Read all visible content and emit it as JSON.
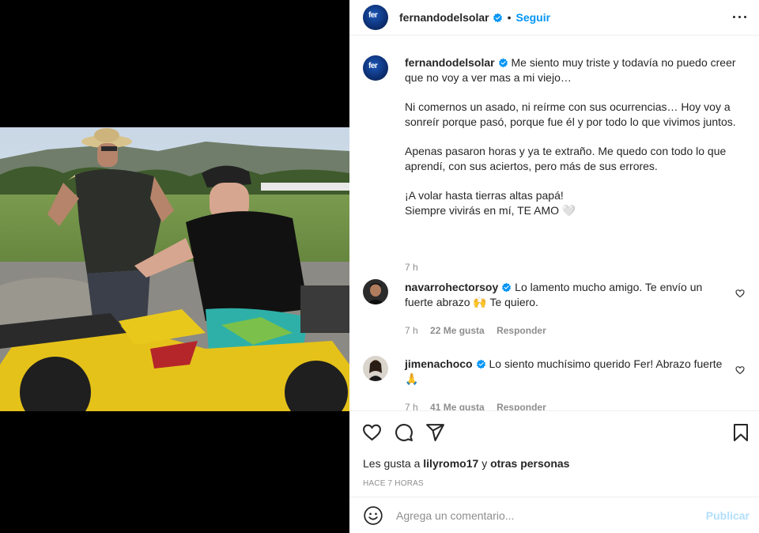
{
  "post": {
    "username": "fernandodelsolar",
    "avatar_text": "fer",
    "follow_label": "Seguir",
    "separator": "•"
  },
  "caption": {
    "username": "fernandodelsolar",
    "paragraphs": [
      "Me siento muy triste y todavía no puedo creer que no voy a ver mas a mi viejo…",
      "Ni comernos un asado, ni reírme con sus ocurrencias… Hoy voy a sonreír porque pasó, porque fue él y por todo lo que vivimos juntos.",
      "Apenas pasaron horas y ya te extraño. Me quedo con todo lo que aprendí, con sus aciertos, pero más de sus errores.",
      "¡A volar hasta tierras altas papá!",
      "Siempre vivirás en mí, TE AMO 🤍"
    ],
    "time": "7 h"
  },
  "comments": [
    {
      "username": "navarrohectorsoy",
      "text": "Lo lamento mucho amigo. Te envío un fuerte abrazo 🙌 Te quiero.",
      "time": "7 h",
      "likes": "22 Me gusta",
      "reply": "Responder"
    },
    {
      "username": "jimenachoco",
      "text": "Lo siento muchísimo querido Fer! Abrazo fuerte 🙏",
      "time": "7 h",
      "likes": "41 Me gusta",
      "reply": "Responder"
    }
  ],
  "likes_line": {
    "prefix": "Les gusta a",
    "user": "lilyromo17",
    "middle": "y",
    "suffix": "otras personas"
  },
  "posted_ago": "HACE 7 HORAS",
  "comment_box": {
    "placeholder": "Agrega un comentario...",
    "publish_label": "Publicar"
  },
  "colors": {
    "accent": "#0095f6",
    "publish_disabled": "#b2dffc",
    "secondary_text": "#8e8e8e",
    "primary_text": "#262626"
  }
}
